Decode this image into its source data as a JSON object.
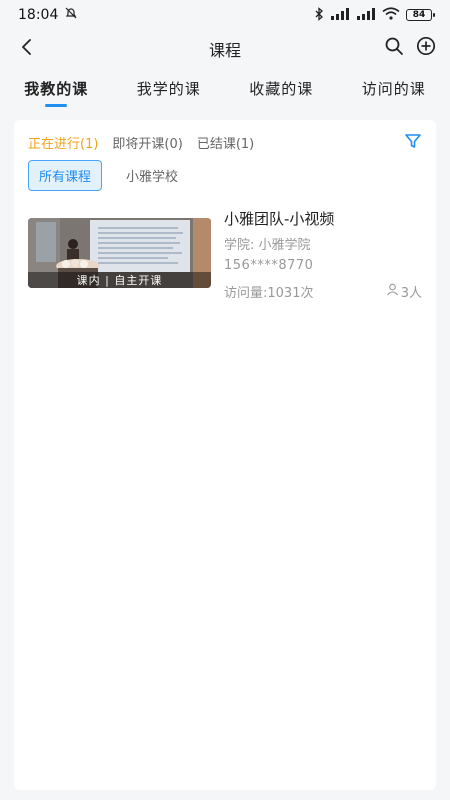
{
  "status_bar": {
    "time": "18:04",
    "battery": "84",
    "signal1": "HD",
    "signal2": "HD"
  },
  "header": {
    "title": "课程"
  },
  "tabs": [
    {
      "label": "我教的课",
      "active": true
    },
    {
      "label": "我学的课",
      "active": false
    },
    {
      "label": "收藏的课",
      "active": false
    },
    {
      "label": "访问的课",
      "active": false
    }
  ],
  "filters": [
    {
      "label": "正在进行(1)",
      "active": true
    },
    {
      "label": "即将开课(0)",
      "active": false
    },
    {
      "label": "已结课(1)",
      "active": false
    }
  ],
  "scopes": [
    {
      "label": "所有课程",
      "active": true
    },
    {
      "label": "小雅学校",
      "active": false
    }
  ],
  "course": {
    "title": "小雅团队-小视频",
    "school": "学院: 小雅学院",
    "teacher": "156****8770",
    "visits": "访问量:1031次",
    "people": "3人",
    "thumb_badge": "课内 | 自主开课"
  },
  "colors": {
    "accent": "#1e8ef1",
    "active_filter": "#f0a21e",
    "background": "#f5f6f8"
  }
}
